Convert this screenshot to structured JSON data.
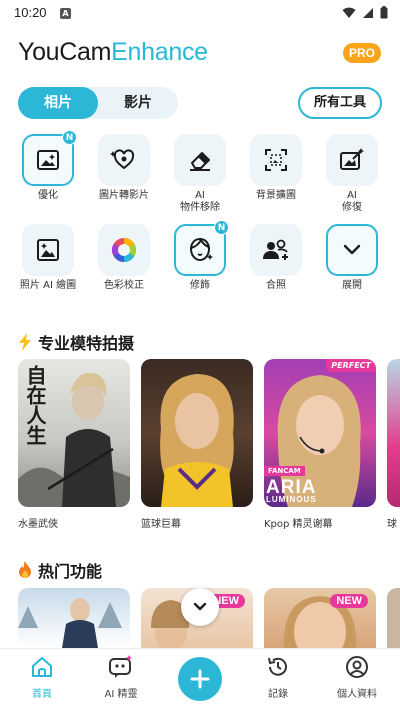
{
  "status_bar": {
    "time": "10:20",
    "notification_letter": "A"
  },
  "header": {
    "logo_part1": "YouCam",
    "logo_part2": "Enhance",
    "pro_badge": "PRO"
  },
  "tabs": {
    "photos": "相片",
    "videos": "影片",
    "all_tools": "所有工具"
  },
  "tools": [
    {
      "label": "優化",
      "icon": "enhance-photo-icon",
      "badge": "N",
      "selected": true
    },
    {
      "label": "圖片轉影片",
      "icon": "image-to-video-icon"
    },
    {
      "label_line1": "AI",
      "label_line2": "物件移除",
      "icon": "eraser-icon"
    },
    {
      "label": "背景擴圖",
      "icon": "expand-frame-icon"
    },
    {
      "label_line1": "AI",
      "label_line2": "修復",
      "icon": "photo-repair-icon"
    },
    {
      "label": "照片 AI 繪圖",
      "icon": "ai-drawing-icon"
    },
    {
      "label": "色彩校正",
      "icon": "color-wheel-icon"
    },
    {
      "label": "修飾",
      "icon": "face-retouch-icon",
      "badge": "N",
      "selected": true
    },
    {
      "label": "合照",
      "icon": "group-photo-icon"
    },
    {
      "label": "展開",
      "icon": "chevron-down-icon",
      "selected": true
    }
  ],
  "section_models": {
    "title": "专业模特拍摄",
    "cards": [
      {
        "label": "水墨武俠",
        "overlay_text": "自在人生"
      },
      {
        "label": "篮球巨幕"
      },
      {
        "label": "Kpop 精灵谢幕",
        "corner_badge": "PERFECT",
        "tag": "FANCAM",
        "title_text": "ARIA",
        "subtitle_text": "LUMINOUS"
      },
      {
        "label": "球"
      }
    ]
  },
  "section_hot": {
    "title": "热门功能",
    "new_badge_left": "NEW",
    "new_badge_right": "NEW"
  },
  "bottom_nav": {
    "home": "首頁",
    "ai_spirit": "AI 精靈",
    "records": "記錄",
    "profile": "個人資料"
  },
  "colors": {
    "accent": "#2cb7d6",
    "pro": "#f9a51a",
    "badge_pink": "#e7389b"
  }
}
